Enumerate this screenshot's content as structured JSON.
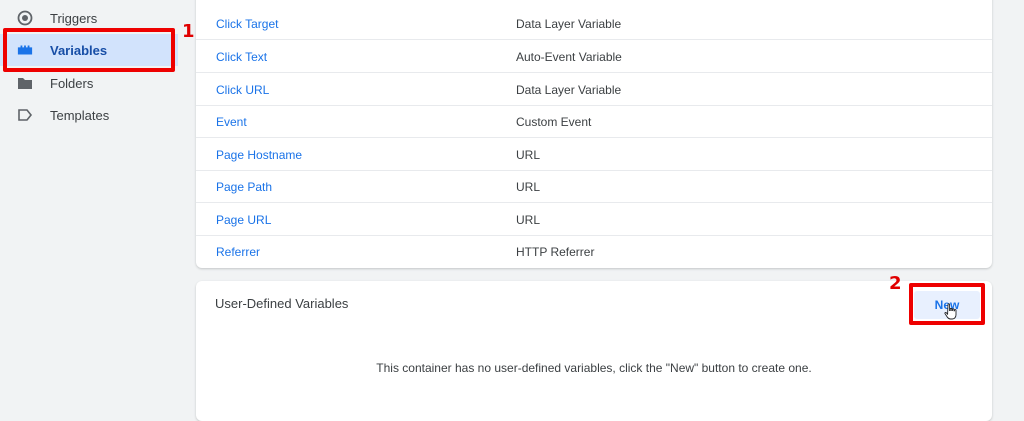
{
  "sidebar": {
    "items": [
      {
        "label": "Triggers",
        "icon": "trigger-icon"
      },
      {
        "label": "Variables",
        "icon": "variables-icon",
        "active": true
      },
      {
        "label": "Folders",
        "icon": "folder-icon"
      },
      {
        "label": "Templates",
        "icon": "template-icon"
      }
    ]
  },
  "annotations": {
    "step1": "1",
    "step2": "2",
    "color": "#ee0000"
  },
  "builtin_variables": [
    {
      "name": "Click Target",
      "type": "Data Layer Variable"
    },
    {
      "name": "Click Text",
      "type": "Auto-Event Variable"
    },
    {
      "name": "Click URL",
      "type": "Data Layer Variable"
    },
    {
      "name": "Event",
      "type": "Custom Event"
    },
    {
      "name": "Page Hostname",
      "type": "URL"
    },
    {
      "name": "Page Path",
      "type": "URL"
    },
    {
      "name": "Page URL",
      "type": "URL"
    },
    {
      "name": "Referrer",
      "type": "HTTP Referrer"
    }
  ],
  "user_defined": {
    "title": "User-Defined Variables",
    "new_label": "New",
    "empty_message": "This container has no user-defined variables, click the \"New\" button to create one."
  },
  "colors": {
    "accent": "#1a73e8",
    "active_bg": "#d2e3fc",
    "page_bg": "#f1f3f4"
  }
}
